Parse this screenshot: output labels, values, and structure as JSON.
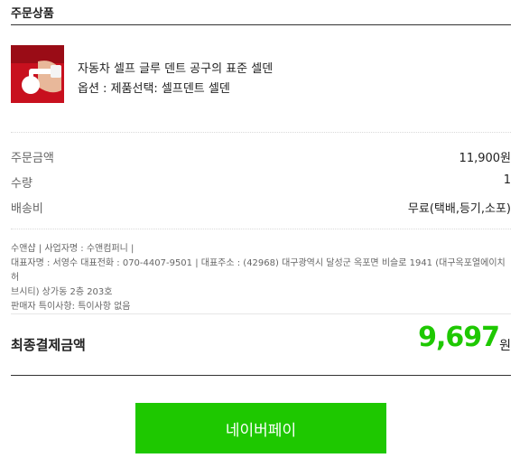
{
  "section_title": "주문상품",
  "product": {
    "name": "자동차 셀프 글루 덴트 공구의 표준 셀덴",
    "option": "옵션 : 제품선택: 셀프덴트 셀덴"
  },
  "summary": {
    "order_amount_label": "주문금액",
    "order_amount_value": "11,900원",
    "quantity_label": "수량",
    "quantity_value": "1",
    "shipping_label": "배송비",
    "shipping_value": "무료(택배,등기,소포)"
  },
  "seller": {
    "line1": "수앤샵 | 사업자명 : 수앤컴퍼니 |",
    "line2": "대표자명 : 서영수 대표전화 : 070-4407-9501 | 대표주소 : (42968) 대구광역시 달성군 옥포면 비슬로 1941 (대구옥포열에이치허",
    "line3": "브시티) 상가동 2층 203호",
    "line4": "판매자 특이사항: 특이사항 없음"
  },
  "final": {
    "label": "최종결제금액",
    "amount": "9,697",
    "unit": "원"
  },
  "pay_button_label": "네이버페이",
  "colors": {
    "accent": "#1ec800",
    "thumbnail_bg": "#c8101e"
  }
}
